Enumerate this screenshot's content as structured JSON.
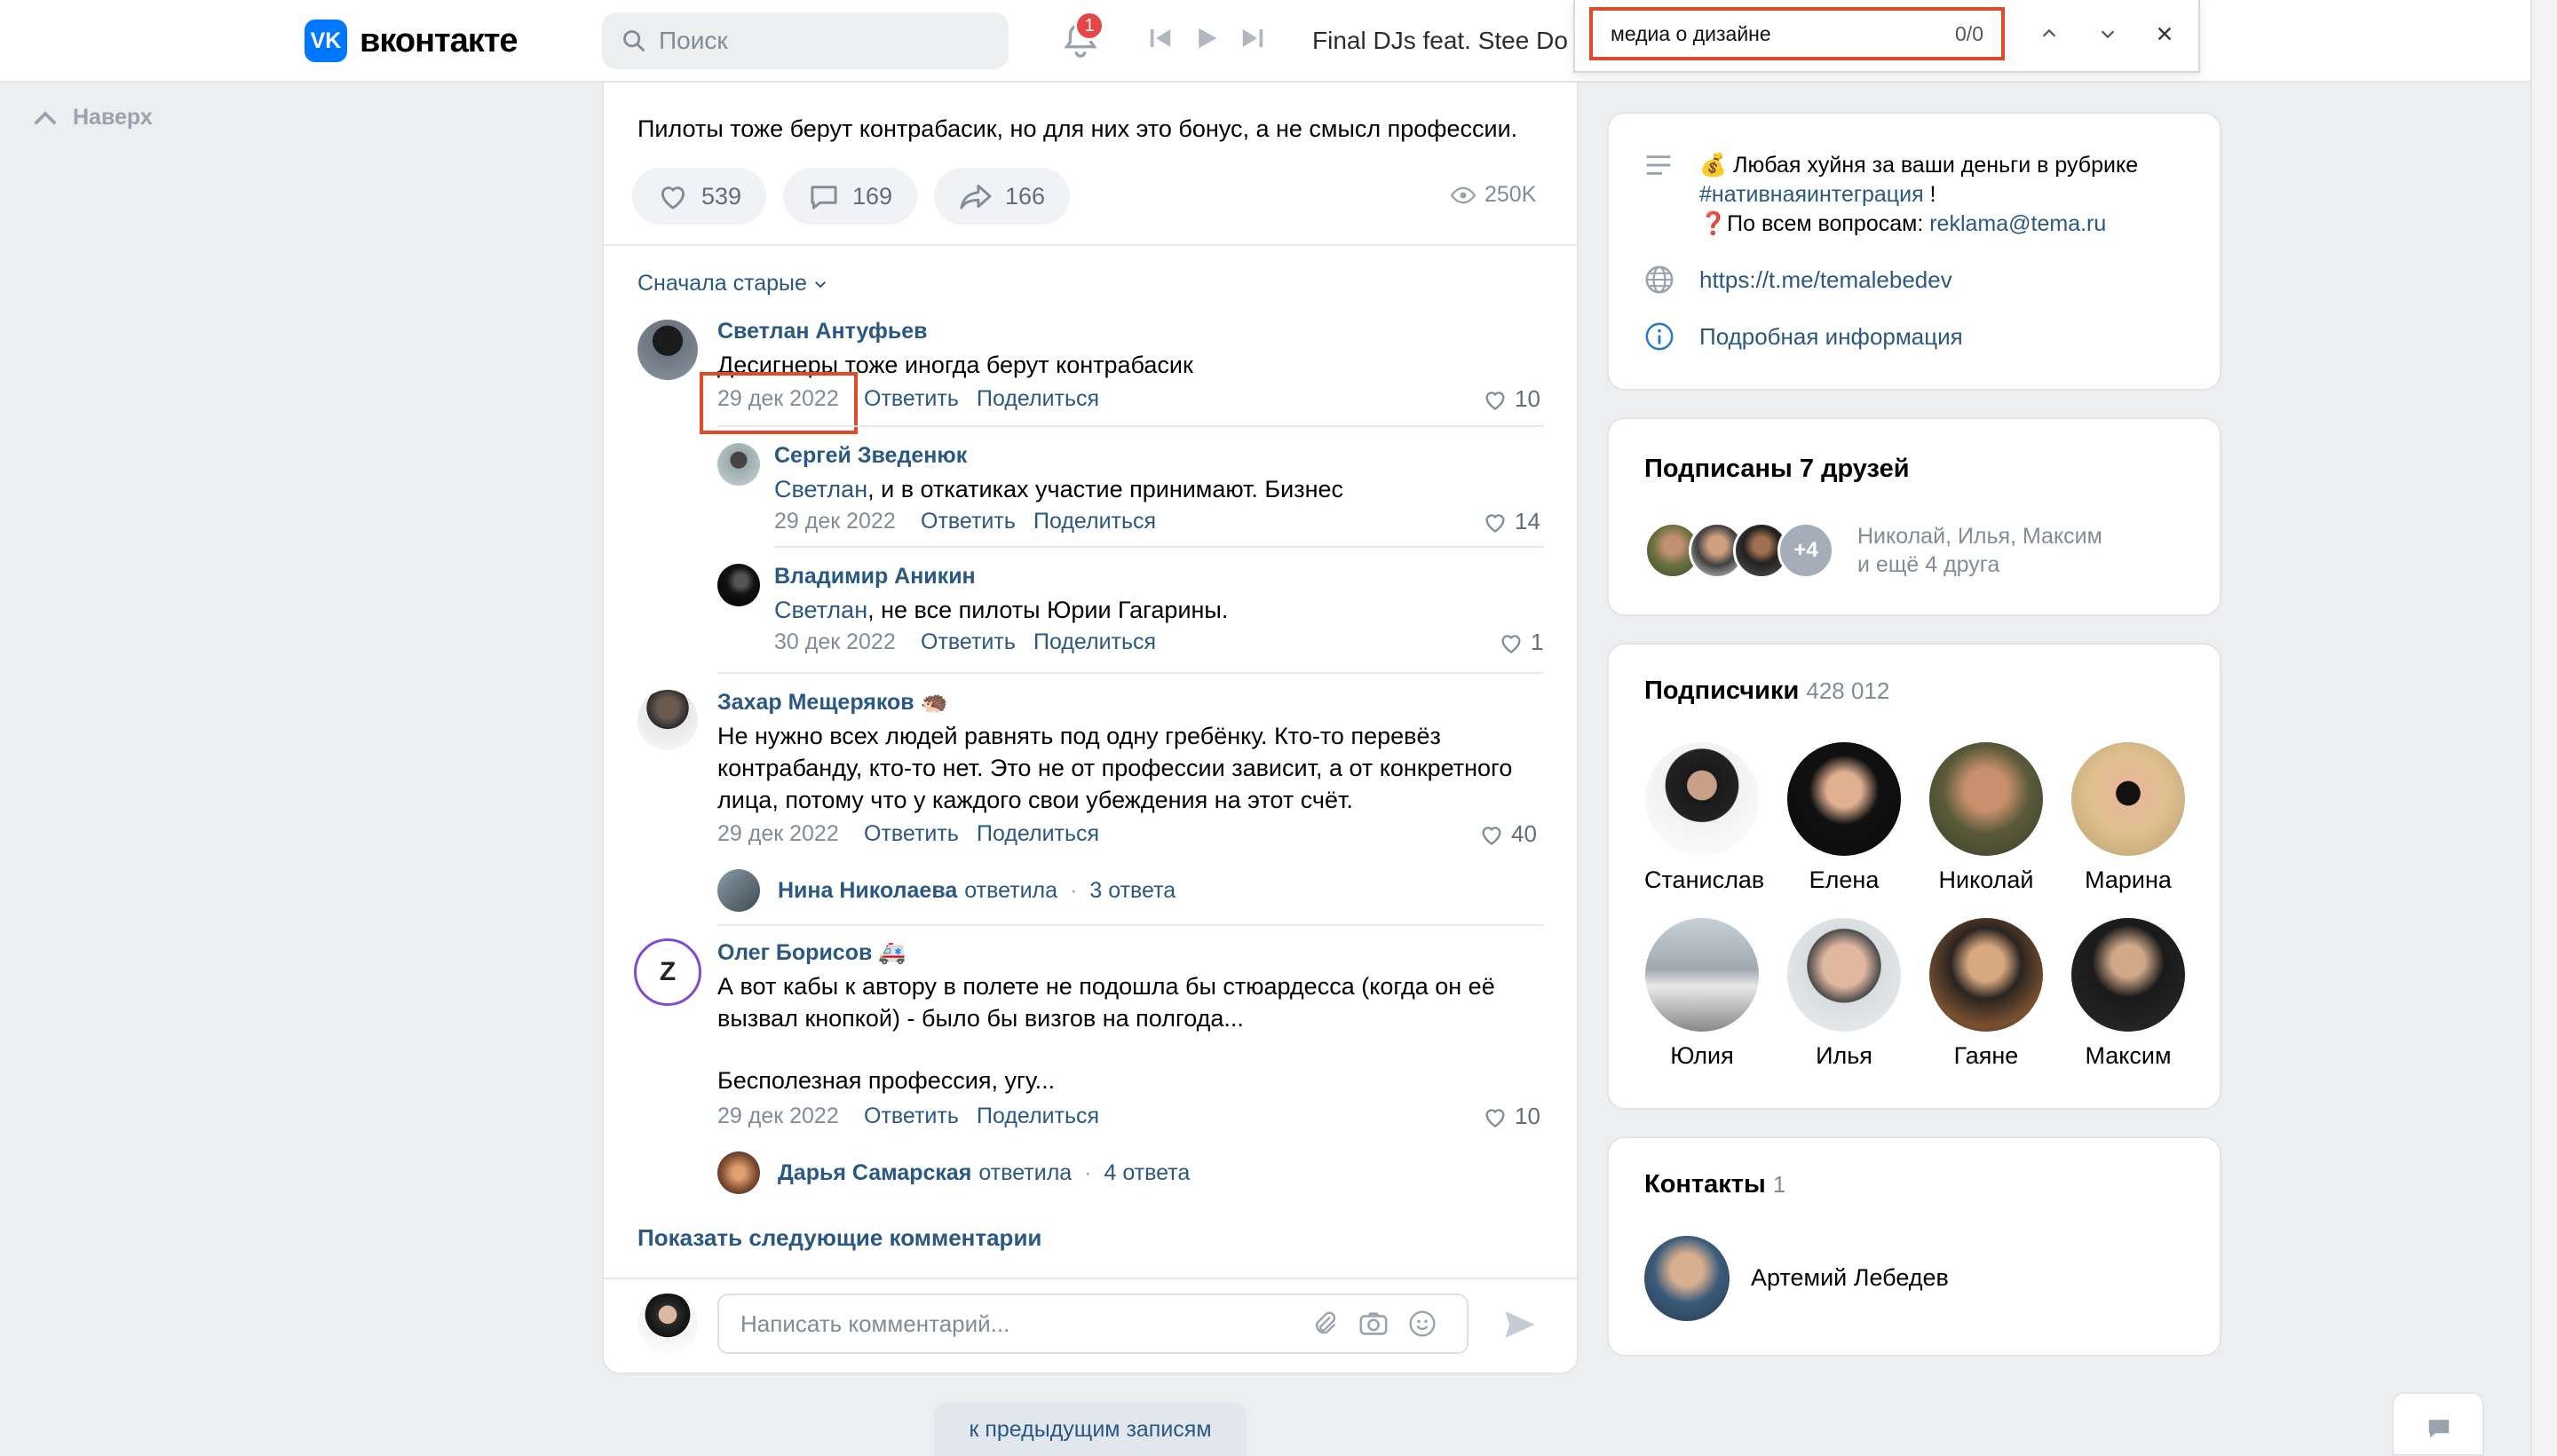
{
  "header": {
    "logo_text": "вконтакте",
    "search_placeholder": "Поиск",
    "notification_count": "1",
    "track_title": "Final DJs feat. Stee Do"
  },
  "find_bar": {
    "query": "медиа о дизайне",
    "matches": "0/0"
  },
  "left": {
    "up_label": "Наверх"
  },
  "post": {
    "text": "Пилоты тоже берут контрабасик, но для них это бонус, а не смысл профессии.",
    "likes": "539",
    "comments": "169",
    "shares": "166",
    "views": "250K",
    "sort_label": "Сначала старые"
  },
  "comments": [
    {
      "author": "Светлан Антуфьев",
      "text": "Десигнеры тоже иногда берут контрабасик",
      "date": "29 дек 2022",
      "reply": "Ответить",
      "share": "Поделиться",
      "likes": "10"
    },
    {
      "author": "Сергей Зведенюк",
      "mention": "Светлан",
      "text": ", и в откатиках участие принимают. Бизнес",
      "date": "29 дек 2022",
      "reply": "Ответить",
      "share": "Поделиться",
      "likes": "14"
    },
    {
      "author": "Владимир Аникин",
      "mention": "Светлан",
      "text": ", не все пилоты Юрии Гагарины.",
      "date": "30 дек 2022",
      "reply": "Ответить",
      "share": "Поделиться",
      "likes": "1"
    },
    {
      "author": "Захар Мещеряков",
      "emoji": "🦔",
      "lines": [
        "Не нужно всех людей равнять под одну гребёнку. Кто-то перевёз",
        "контрабанду, кто-то нет. Это не от профессии зависит, а от конкретного",
        "лица, потому что у каждого свои убеждения на этот счёт."
      ],
      "date": "29 дек 2022",
      "reply": "Ответить",
      "share": "Поделиться",
      "likes": "40",
      "thread_author": "Нина Николаева",
      "thread_verb": "ответила",
      "thread_count": "3 ответа"
    },
    {
      "author": "Олег Борисов",
      "emoji": "🚑",
      "lines": [
        "А вот кабы к автору в полете не подошла бы стюардесса (когда он её",
        "вызвал кнопкой) - было бы визгов на полгода...",
        "",
        "Бесполезная профессия, угу..."
      ],
      "date": "29 дек 2022",
      "reply": "Ответить",
      "share": "Поделиться",
      "likes": "10",
      "thread_author": "Дарья Самарская",
      "thread_verb": "ответила",
      "thread_count": "4 ответа"
    }
  ],
  "show_more": "Показать следующие комментарии",
  "comment_placeholder": "Написать комментарий...",
  "prev_posts": "к предыдущим записям",
  "info": {
    "line1": "💰 Любая хуйня за ваши деньги в рубрике",
    "hashtag": "#нативнаяинтеграция",
    "line2_suffix": " !",
    "line3_prefix": "❓По всем вопросам: ",
    "email": "reklama@tema.ru",
    "link": "https://t.me/temalebedev",
    "more": "Подробная информация"
  },
  "friends": {
    "title": "Подписаны 7 друзей",
    "more_badge": "+4",
    "names": "Николай, Илья, Максим",
    "extra": "и ещё 4 друга"
  },
  "subscribers": {
    "title": "Подписчики",
    "count": "428 012",
    "people": [
      "Станислав",
      "Елена",
      "Николай",
      "Марина",
      "Юлия",
      "Илья",
      "Гаяне",
      "Максим"
    ]
  },
  "contacts": {
    "title": "Контакты",
    "count": "1",
    "name": "Артемий Лебедев"
  }
}
